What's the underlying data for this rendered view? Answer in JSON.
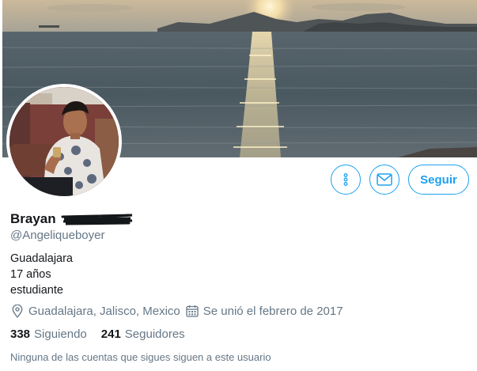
{
  "colors": {
    "accent": "#1da1f2",
    "secondary_text": "#657786",
    "primary_text": "#14171a"
  },
  "banner": {
    "image": "sunset-over-sea-photo"
  },
  "avatar": {
    "image": "profile-photo"
  },
  "actions": {
    "more_icon": "more-vertical-icon",
    "message_icon": "envelope-icon",
    "follow_label": "Seguir"
  },
  "profile": {
    "name": "Brayan",
    "handle": "@Angeliqueboyer",
    "bio_lines": [
      "Guadalajara",
      "17 años",
      "estudiante"
    ],
    "location": "Guadalajara, Jalisco, Mexico",
    "joined": "Se unió el febrero de 2017",
    "following_count": "338",
    "following_label": "Siguiendo",
    "followers_count": "241",
    "followers_label": "Seguidores",
    "mutual_note": "Ninguna de las cuentas que sigues siguen a este usuario"
  }
}
